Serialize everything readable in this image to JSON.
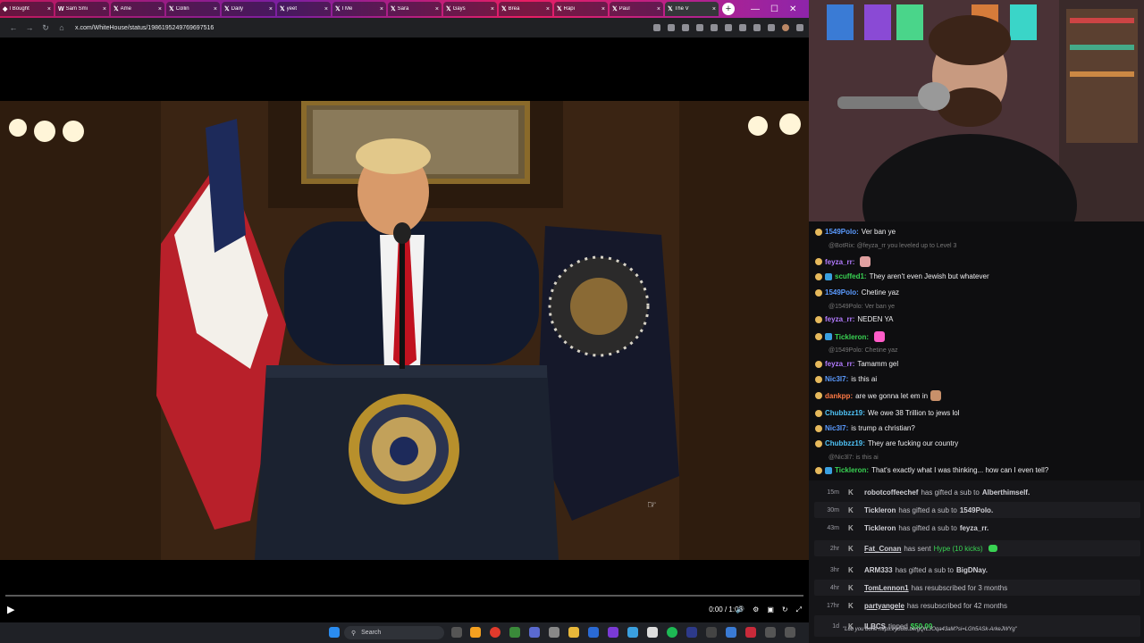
{
  "browser": {
    "tabs": [
      {
        "icon": "twitch-icon",
        "label": "I Bought"
      },
      {
        "icon": "w-icon",
        "label": "Sam Smi"
      },
      {
        "icon": "x-icon",
        "label": "Ame"
      },
      {
        "icon": "x-icon",
        "label": "Collin"
      },
      {
        "icon": "x-icon",
        "label": "Daily"
      },
      {
        "icon": "x-icon",
        "label": "yeet"
      },
      {
        "icon": "x-icon",
        "label": "I Me"
      },
      {
        "icon": "x-icon",
        "label": "Sara"
      },
      {
        "icon": "x-icon",
        "label": "Gays"
      },
      {
        "icon": "x-icon",
        "label": "Brea"
      },
      {
        "icon": "x-icon",
        "label": "Rapi"
      },
      {
        "icon": "x-icon",
        "label": "Paul"
      },
      {
        "icon": "x-icon",
        "label": "The V"
      }
    ],
    "url": "x.com/WhiteHouse/status/1986195249769697516"
  },
  "video": {
    "time": "0:00 / 1:06",
    "progress": 0.0,
    "seal_top": "PRESIDENT OF THE UNITED",
    "seal_bottom": "SEAL OF THE",
    "seal_right": "STATES"
  },
  "chat": {
    "messages": [
      {
        "user": "1549Polo",
        "color": "#5b9bff",
        "text": "Ver ban ye"
      },
      {
        "reply": "@BotRix: @feyza_rr you leveled up to Level 3"
      },
      {
        "user": "feyza_rr",
        "color": "#b37bff",
        "text": ""
      },
      {
        "user": "scuffed1",
        "color": "#39d353",
        "text": "They aren't even Jewish but whatever"
      },
      {
        "user": "1549Polo",
        "color": "#5b9bff",
        "text": "Chetine yaz"
      },
      {
        "reply": "@1549Polo: Ver ban ye"
      },
      {
        "user": "feyza_rr",
        "color": "#b37bff",
        "text": "NEDEN YA"
      },
      {
        "user": "Tickleron",
        "color": "#39d353",
        "text": ""
      },
      {
        "reply": "@1549Polo: Chetine yaz"
      },
      {
        "user": "feyza_rr",
        "color": "#b37bff",
        "text": "Tamamm gel"
      },
      {
        "user": "Nic3l7",
        "color": "#5b9bff",
        "text": "is this ai"
      },
      {
        "user": "dankpp",
        "color": "#ff7a45",
        "text": "are we gonna let em in"
      },
      {
        "user": "Chubbzz19",
        "color": "#4fc3f7",
        "text": "We owe 38 Trillion to jews lol"
      },
      {
        "user": "Nic3l7",
        "color": "#5b9bff",
        "text": "is trump a christian?"
      },
      {
        "user": "Chubbzz19",
        "color": "#4fc3f7",
        "text": "They are fucking our country"
      },
      {
        "reply": "@Nic3l7: is this ai"
      },
      {
        "user": "Tickleron",
        "color": "#39d353",
        "text": "That's exactly what I was thinking... how can I even tell?"
      }
    ]
  },
  "events": [
    {
      "time": "15m",
      "user": "robotcoffeechef",
      "text": "has gifted a sub to",
      "target": "Alberthimself."
    },
    {
      "time": "30m",
      "user": "Tickleron",
      "text": "has gifted a sub to",
      "target": "1549Polo."
    },
    {
      "time": "43m",
      "user": "Tickleron",
      "text": "has gifted a sub to",
      "target": "feyza_rr."
    },
    {
      "time": "2hr",
      "user": "Fat_Conan",
      "text": "has sent",
      "hype": "Hype (10 kicks)"
    },
    {
      "time": "3hr",
      "user": "ARM333",
      "text": "has gifted a sub to",
      "target": "BigDNay."
    },
    {
      "time": "4hr",
      "user": "TomLennon1",
      "text": "has resubscribed for 3 months"
    },
    {
      "time": "17hr",
      "user": "partyangele",
      "text": "has resubscribed for 42 months"
    },
    {
      "time": "1d",
      "user": "ILBCS",
      "text": "tipped",
      "amount": "$50.00",
      "quote": "\"Lub you bone https://youtu.be/gQrLJOqa43aM?si=LGh5ASk-ArkeJWYg\""
    }
  ],
  "taskbar": {
    "search_placeholder": "Search"
  },
  "colors": {
    "chat_bg": "#0e0e10",
    "events_bg": "#151518",
    "accent_green": "#39d353"
  }
}
